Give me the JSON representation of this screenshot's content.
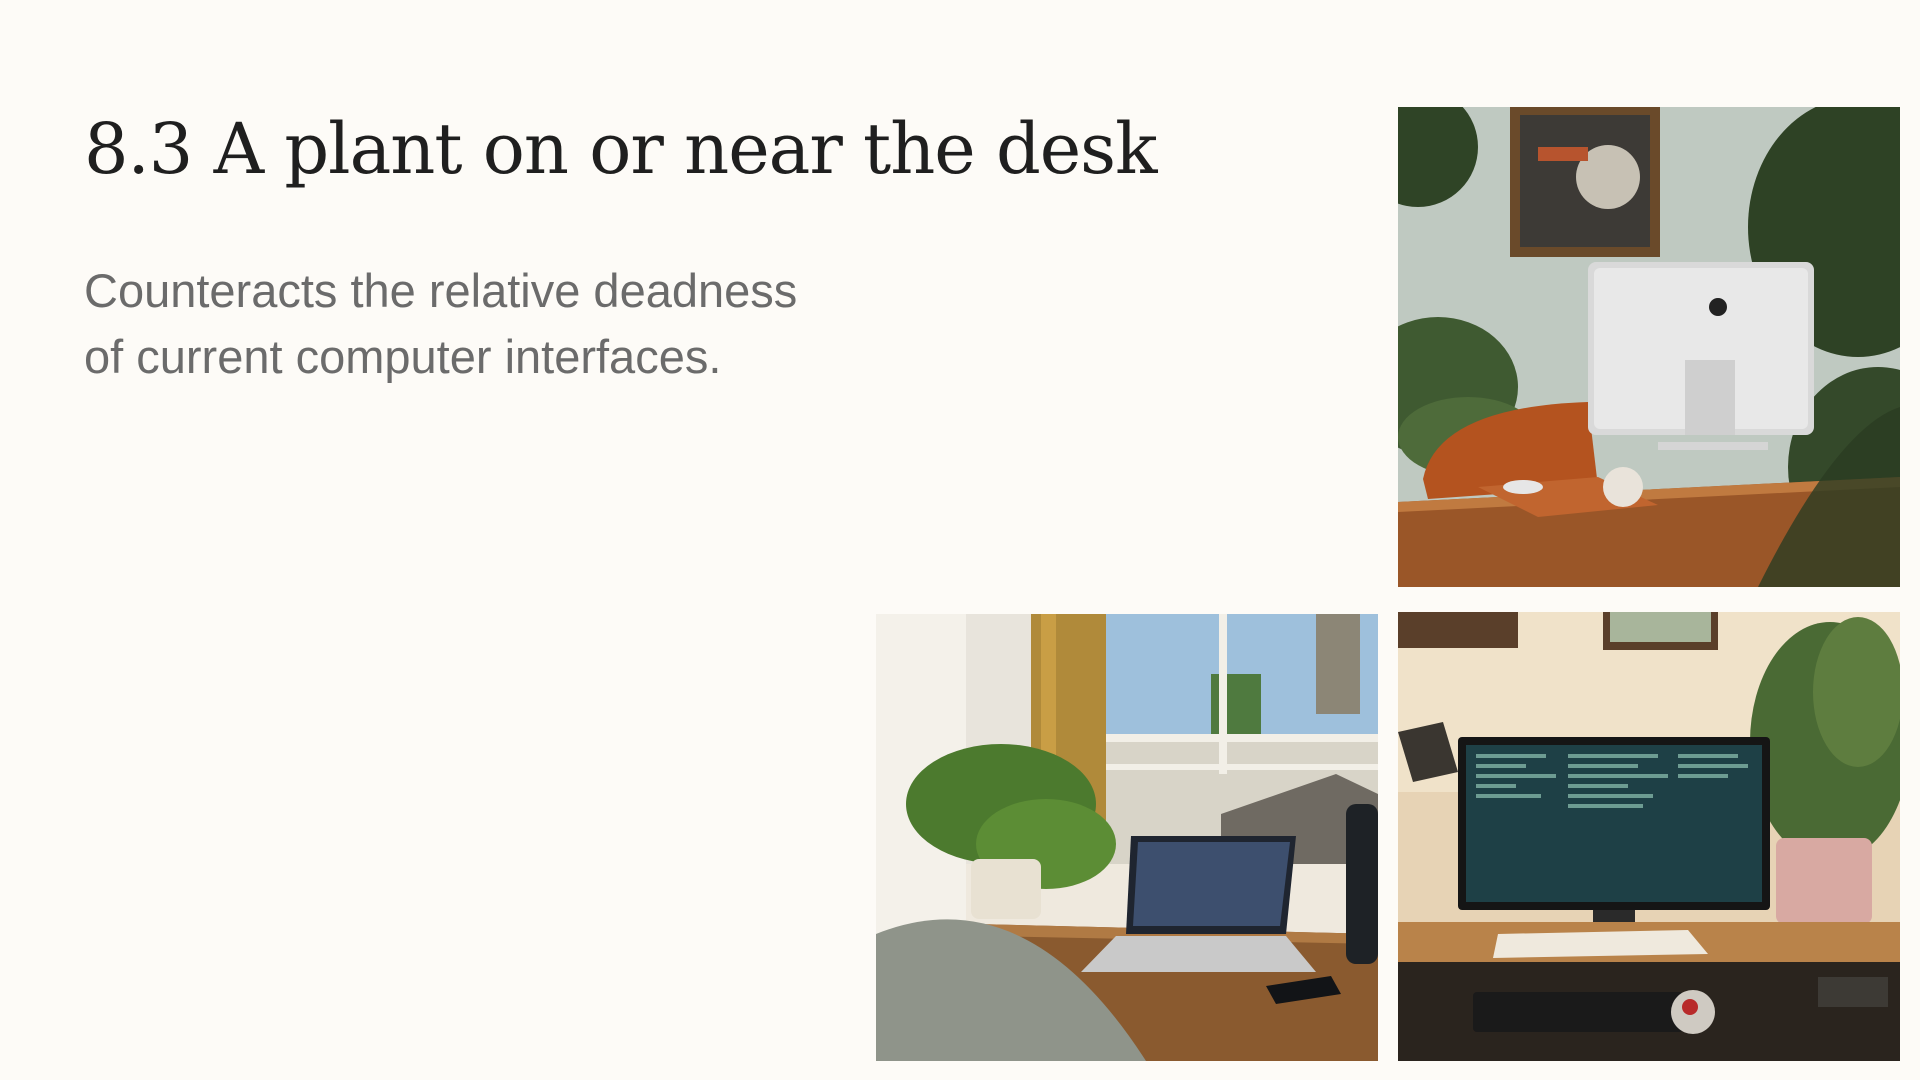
{
  "slide": {
    "title": "8.3 A plant on or near the desk",
    "subtitle_lines": [
      "Counteracts the relative deadness",
      "of current computer interfaces."
    ]
  },
  "photos": [
    {
      "icon": "photo-imac-plants"
    },
    {
      "icon": "photo-laptop-window-plant"
    },
    {
      "icon": "photo-monitor-code-plant"
    }
  ],
  "colors": {
    "background": "#fdfbf7",
    "title": "#1f1f1f",
    "subtitle": "#6b6b6b"
  }
}
